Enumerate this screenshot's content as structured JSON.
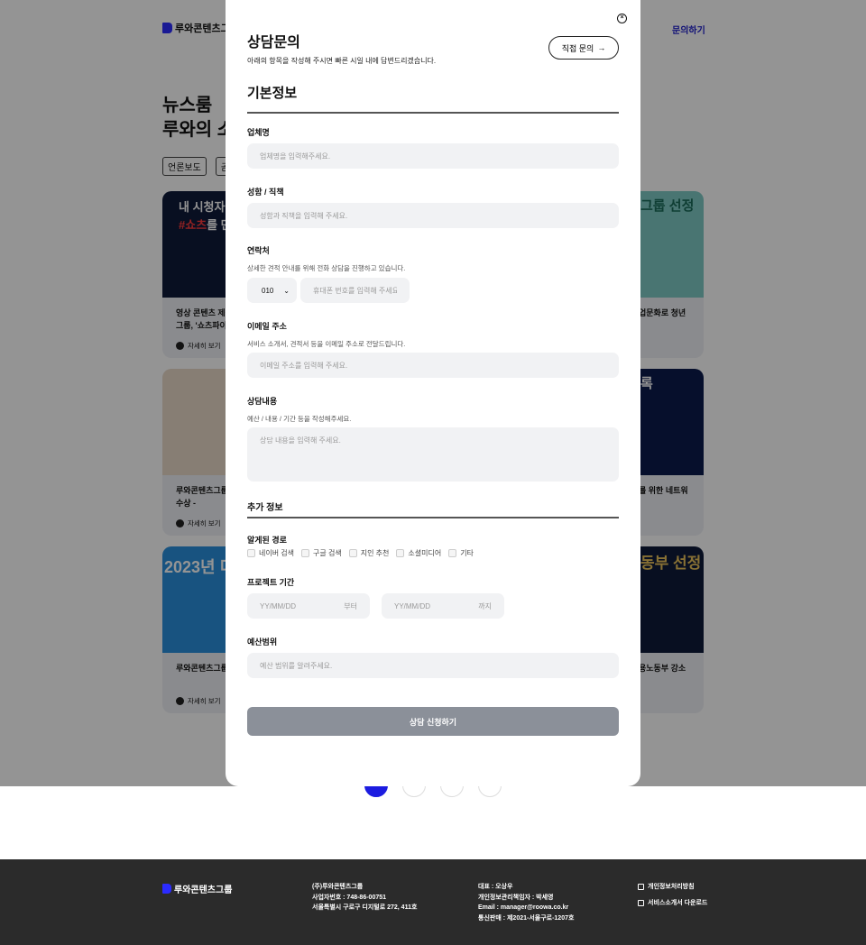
{
  "brand": {
    "name": "루와콘텐츠그룹",
    "accent": "#2b2bff"
  },
  "header": {
    "contact_link": "문의하기"
  },
  "news": {
    "title_line1": "뉴스룸",
    "title_line2": "루와의 소",
    "chips": [
      "언론보도",
      "곧"
    ],
    "cards": [
      {
        "thumb_line1": "내 시청자",
        "thumb_red": "#쇼츠",
        "thumb_rest": "를 만",
        "left_title": "영상 콘텐츠 제작 그룹, '쇼츠파이'",
        "right_title": "업문화로 청년",
        "right_badge": "그룹 선정",
        "more": "자세히 보기"
      },
      {
        "left_title": "루와콘텐츠그룹 드 수상 -",
        "right_title": "를 위한 네트워",
        "right_badge": "록",
        "more": "자세히 보기"
      },
      {
        "thumb_text": "2023년 디정시",
        "left_title": "루와콘텐츠그룹",
        "right_title": "용노동부 강소",
        "right_badge": "동부 선정",
        "more": "자세히 보기"
      }
    ]
  },
  "modal": {
    "title": "상담문의",
    "subtitle": "아래의 항목을 작성해 주시면 빠른 시일 내에 답변드리겠습니다.",
    "direct_button": "직접 문의",
    "section_basic": "기본정보",
    "company": {
      "label": "업체명",
      "placeholder": "업체명을 입력해주세요."
    },
    "name": {
      "label": "성함 / 직책",
      "placeholder": "성함과 직책을 입력해 주세요."
    },
    "phone": {
      "label": "연락처",
      "hint": "상세한 견적 안내를 위해 전화 상담을 진행하고 있습니다.",
      "prefix": "010",
      "placeholder": "휴대폰 번호를 입력해 주세요"
    },
    "email": {
      "label": "이메일 주소",
      "hint": "서비스 소개서, 견적서 등을 이메일 주소로 전달드립니다.",
      "placeholder": "이메일 주소를 입력해 주세요."
    },
    "content": {
      "label": "상담내용",
      "hint": "예산 / 내용 / 기간 등을 작성해주세요.",
      "placeholder": "상담 내용을 입력해 주세요."
    },
    "section_extra": "추가 정보",
    "source": {
      "label": "알게된 경로",
      "options": [
        "네이버 검색",
        "구글 검색",
        "지인 추천",
        "소셜미디어",
        "기타"
      ]
    },
    "period": {
      "label": "프로젝트 기간",
      "from_placeholder": "YY/MM/DD",
      "from_suffix": "부터",
      "to_placeholder": "YY/MM/DD",
      "to_suffix": "까지"
    },
    "budget": {
      "label": "예산범위",
      "placeholder": "예산 범위를 알려주세요."
    },
    "submit": "상담 신청하기"
  },
  "footer": {
    "company": "(주)루와콘텐츠그룹",
    "biz_no": "사업자번호 : 748-86-00751",
    "address": "서울특별시 구로구 디지털로 272, 411호",
    "ceo": "대표 : 오상우",
    "privacy_officer": "개인정보관리책임자 : 박세영",
    "email": "Email : manager@roowa.co.kr",
    "ecommerce": "통신판매 : 제2021-서울구로-1207호",
    "privacy_policy": "개인정보처리방침",
    "brochure": "서비스소개서 다운로드"
  }
}
